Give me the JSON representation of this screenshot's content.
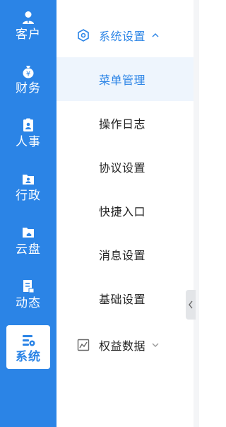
{
  "rail": {
    "items": [
      {
        "label": "客户",
        "icon": "customer-icon"
      },
      {
        "label": "财务",
        "icon": "finance-icon"
      },
      {
        "label": "人事",
        "icon": "personnel-icon"
      },
      {
        "label": "行政",
        "icon": "admin-icon"
      },
      {
        "label": "云盘",
        "icon": "cloud-disk-icon"
      },
      {
        "label": "动态",
        "icon": "activity-icon"
      },
      {
        "label": "系统",
        "icon": "system-icon",
        "active": true
      }
    ]
  },
  "menu": {
    "group": {
      "label": "系统设置",
      "icon": "settings-icon",
      "expanded": true
    },
    "items": [
      {
        "label": "菜单管理",
        "selected": true
      },
      {
        "label": "操作日志"
      },
      {
        "label": "协议设置"
      },
      {
        "label": "快捷入口"
      },
      {
        "label": "消息设置"
      },
      {
        "label": "基础设置"
      }
    ],
    "group2": {
      "label": "权益数据",
      "icon": "chart-icon",
      "expanded": false
    }
  },
  "colors": {
    "accent": "#2b84e6",
    "selected_bg": "#eef5fd"
  }
}
